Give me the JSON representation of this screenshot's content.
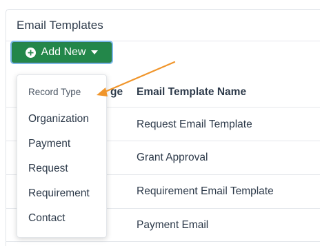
{
  "card": {
    "title": "Email Templates"
  },
  "add_button": {
    "label": "Add New"
  },
  "dropdown": {
    "header": "Record Type",
    "items": [
      {
        "label": "Organization"
      },
      {
        "label": "Payment"
      },
      {
        "label": "Request"
      },
      {
        "label": "Requirement"
      },
      {
        "label": "Contact"
      }
    ]
  },
  "table": {
    "type_header_fragment": "ge",
    "name_header": "Email Template Name",
    "rows": [
      {
        "name": "Request Email Template"
      },
      {
        "name": "Grant Approval"
      },
      {
        "name": "Requirement Email Template"
      },
      {
        "name": "Payment Email"
      }
    ]
  },
  "colors": {
    "button_green": "#23874a",
    "button_focus_ring": "#7ab8e8",
    "annotation_arrow": "#f0952b"
  }
}
